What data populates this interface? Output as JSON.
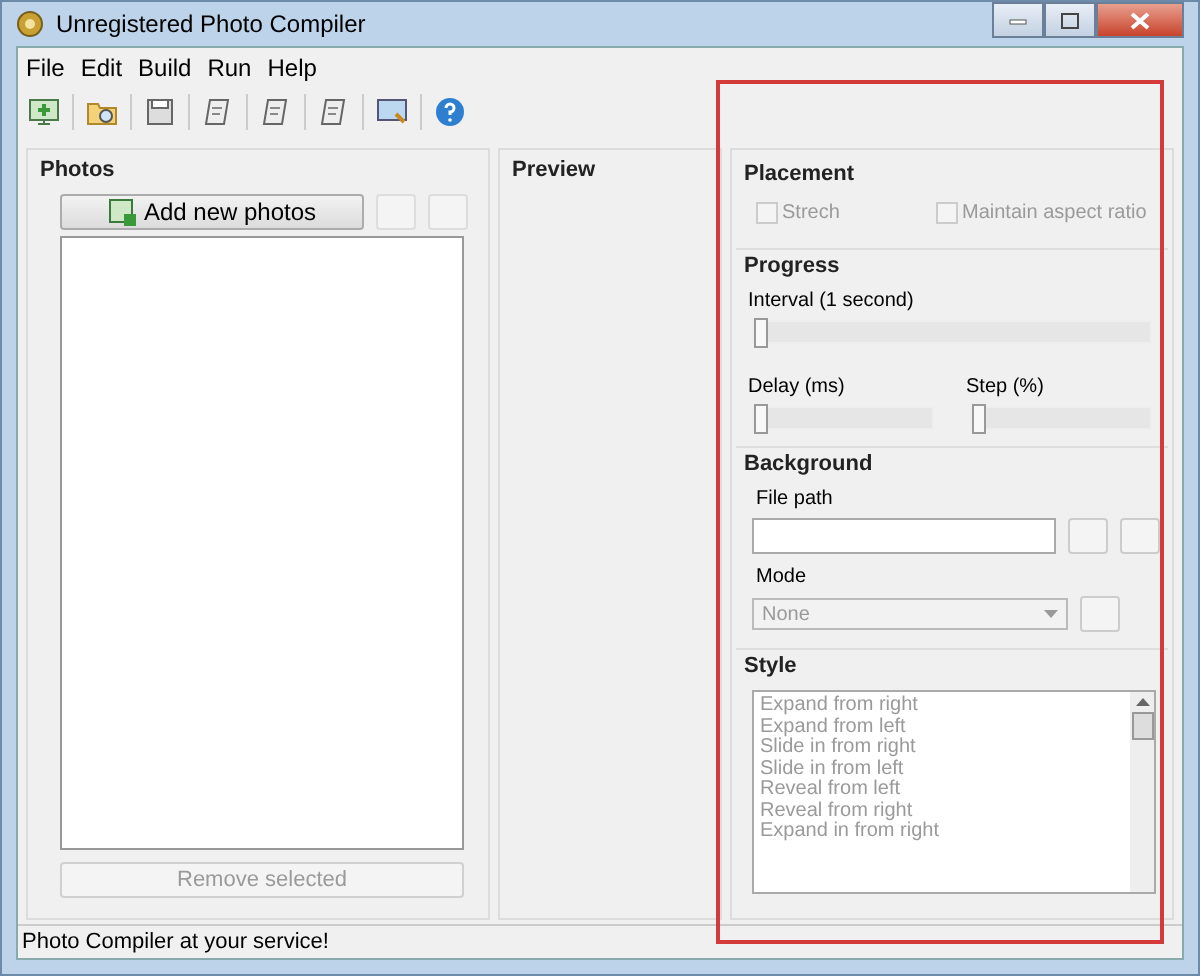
{
  "window": {
    "title": "Unregistered Photo Compiler"
  },
  "menu": [
    "File",
    "Edit",
    "Build",
    "Run",
    "Help"
  ],
  "toolbar": [
    {
      "kind": "screen"
    },
    {
      "kind": "folder"
    },
    {
      "kind": "save"
    },
    {
      "kind": "page"
    },
    {
      "kind": "page"
    },
    {
      "kind": "page"
    },
    {
      "kind": "monitor"
    },
    {
      "kind": "help"
    }
  ],
  "photos": {
    "title": "Photos",
    "add_button": "Add new photos",
    "remove_button": {
      "label": "Remove selected",
      "disabled": true
    }
  },
  "preview": {
    "title": "Preview"
  },
  "placement": {
    "title": "Placement",
    "options": [
      {
        "label": "Strech",
        "checked": false,
        "disabled": true
      },
      {
        "label": "Maintain aspect ratio",
        "checked": false,
        "disabled": true
      }
    ]
  },
  "progress": {
    "title": "Progress",
    "interval": {
      "label": "Interval (1 second)",
      "level": 0
    },
    "delay": {
      "label": "Delay (ms)",
      "level": 0
    },
    "step": {
      "label": "Step (%)",
      "level": 0
    }
  },
  "background": {
    "title": "Background",
    "file_path_label": "File path",
    "mode_label": "Mode",
    "mode": {
      "value": "None",
      "disabled": true
    }
  },
  "style": {
    "title": "Style",
    "disabled": true,
    "items": [
      "Expand from right",
      "Expand from left",
      "Slide in from right",
      "Slide in from left",
      "Reveal from left",
      "Reveal from right",
      "Expand in from right"
    ]
  },
  "status_bar": "Photo Compiler at your service!"
}
